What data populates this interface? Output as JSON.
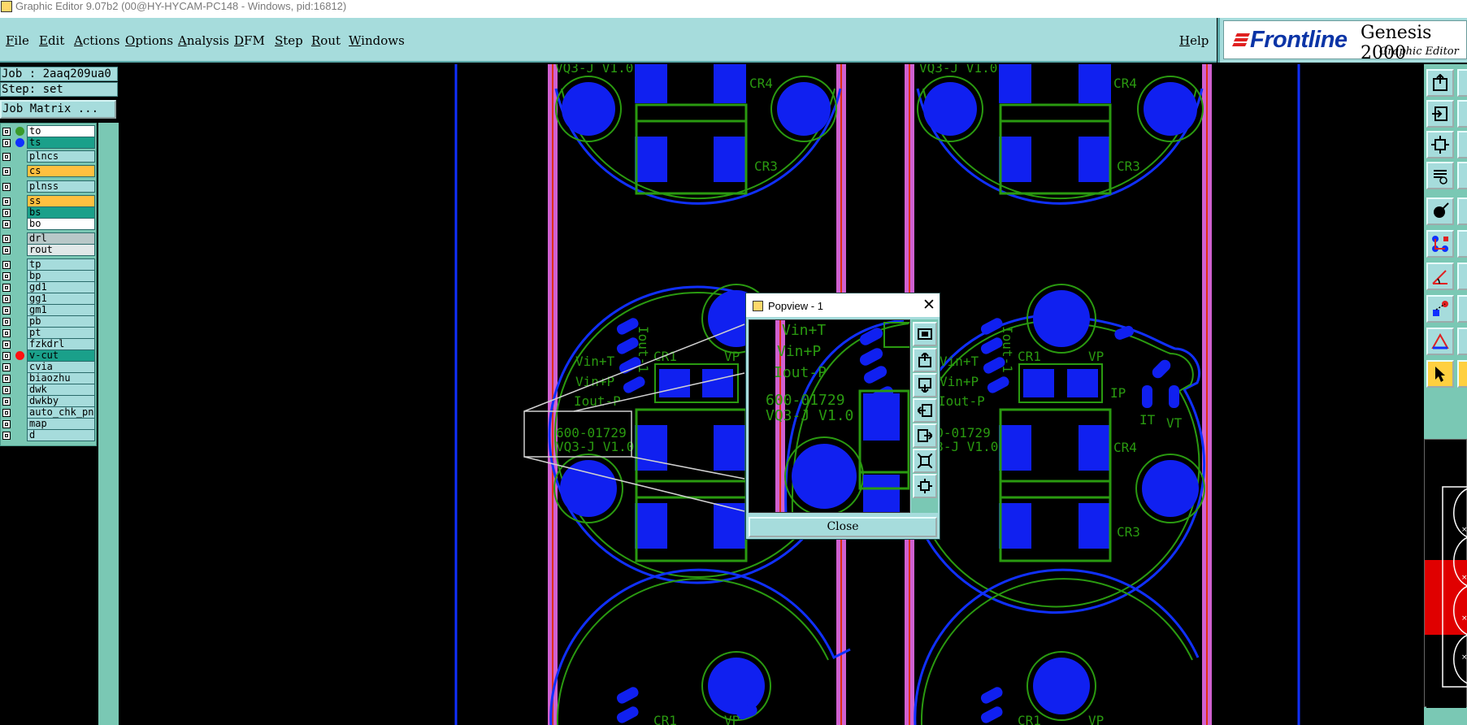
{
  "window": {
    "title": "Graphic Editor 9.07b2 (00@HY-HYCAM-PC148 - Windows, pid:16812)"
  },
  "menu": {
    "items": [
      "File",
      "Edit",
      "Actions",
      "Options",
      "Analysis",
      "DFM",
      "Step",
      "Rout",
      "Windows"
    ],
    "help": "Help"
  },
  "logo": {
    "brand": "Frontline",
    "product": "Genesis 2000",
    "subtitle": "Graphic Editor"
  },
  "job": {
    "job_line": "Job : 2aaq209ua0",
    "step_line": "Step: set",
    "job_matrix_label": "Job Matrix ..."
  },
  "layers": [
    {
      "name": "to",
      "color": "#ffffff",
      "dot": "#3a9a2a"
    },
    {
      "name": "ts",
      "color": "#1aa08a",
      "dot": "#1030ff"
    },
    {
      "name": "plncs",
      "color": "#a6dcdc",
      "dot": ""
    },
    {
      "name": "cs",
      "color": "#ffc040",
      "dot": ""
    },
    {
      "name": "plnss",
      "color": "#a6dcdc",
      "dot": ""
    },
    {
      "name": "ss",
      "color": "#ffc040",
      "dot": ""
    },
    {
      "name": "bs",
      "color": "#1aa08a",
      "dot": ""
    },
    {
      "name": "bo",
      "color": "#ffffff",
      "dot": ""
    },
    {
      "name": "drl",
      "color": "#b8c8c8",
      "dot": ""
    },
    {
      "name": "rout",
      "color": "#e0e8e8",
      "dot": ""
    },
    {
      "name": "tp",
      "color": "#a6dcdc",
      "dot": ""
    },
    {
      "name": "bp",
      "color": "#a6dcdc",
      "dot": ""
    },
    {
      "name": "gd1",
      "color": "#a6dcdc",
      "dot": ""
    },
    {
      "name": "gg1",
      "color": "#a6dcdc",
      "dot": ""
    },
    {
      "name": "gm1",
      "color": "#a6dcdc",
      "dot": ""
    },
    {
      "name": "pb",
      "color": "#a6dcdc",
      "dot": ""
    },
    {
      "name": "pt",
      "color": "#a6dcdc",
      "dot": ""
    },
    {
      "name": "fzkdrl",
      "color": "#a6dcdc",
      "dot": ""
    },
    {
      "name": "v-cut",
      "color": "#1aa08a",
      "dot": "#ff1010"
    },
    {
      "name": "cvia",
      "color": "#a6dcdc",
      "dot": ""
    },
    {
      "name": "biaozhu",
      "color": "#a6dcdc",
      "dot": ""
    },
    {
      "name": "dwk",
      "color": "#a6dcdc",
      "dot": ""
    },
    {
      "name": "dwkby",
      "color": "#a6dcdc",
      "dot": ""
    },
    {
      "name": "auto_chk_pn..",
      "color": "#a6dcdc",
      "dot": ""
    },
    {
      "name": "map",
      "color": "#a6dcdc",
      "dot": ""
    },
    {
      "name": "d",
      "color": "#a6dcdc",
      "dot": ""
    }
  ],
  "board": {
    "ref_cr1": "CR1",
    "ref_cr3": "CR3",
    "ref_cr4": "CR4",
    "ref_vp": "VP",
    "ref_ip": "IP",
    "ref_it": "IT",
    "ref_vt": "VT",
    "vin_t": "Vin+T",
    "vin_p": "Vin+P",
    "iout_p": "Iout-P",
    "iout_n": "Iout-1",
    "part_no": "600-01729",
    "ver": "VQ3-J V1.0"
  },
  "popview": {
    "title": "Popview - 1",
    "close_label": "Close"
  },
  "colors": {
    "panel": "#a6dcdc",
    "pad": "#1020f0",
    "silk": "#2a9a10",
    "outline": "#1030ff",
    "rail": "#d060d0"
  }
}
